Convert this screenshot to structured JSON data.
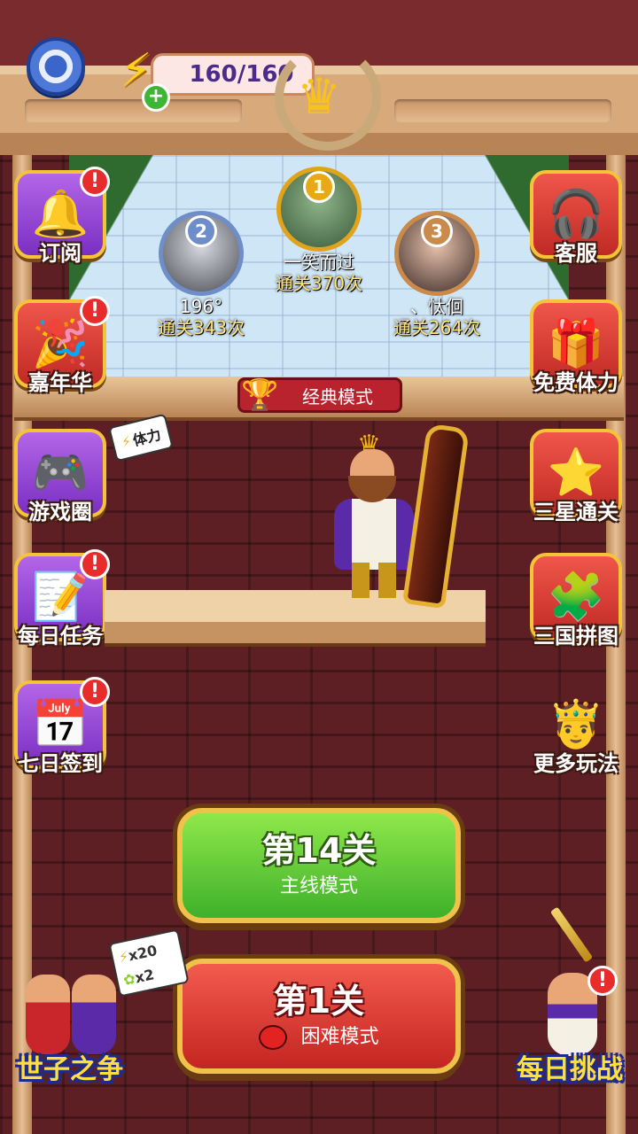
{
  "topbar": {
    "energy": "160/160",
    "plus": "+"
  },
  "leaderboard": {
    "mode_label": "经典模式",
    "players": [
      {
        "rank": "1",
        "name": "一笑而过",
        "count": "通关370次"
      },
      {
        "rank": "2",
        "name": "196°",
        "count": "通关343次"
      },
      {
        "rank": "3",
        "name": "、忲佪",
        "count": "通关264次"
      }
    ]
  },
  "left_menu": [
    {
      "label": "订阅",
      "icon": "bell-icon",
      "glyph": "🔔",
      "badge": "!"
    },
    {
      "label": "嘉年华",
      "icon": "party-popper-icon",
      "glyph": "🎉",
      "badge": "!"
    },
    {
      "label": "游戏圈",
      "icon": "gamepad-icon",
      "glyph": "🎮",
      "tag": "体力"
    },
    {
      "label": "每日任务",
      "icon": "notebook-pencil-icon",
      "glyph": "📝",
      "badge": "!"
    },
    {
      "label": "七日签到",
      "icon": "calendar-check-icon",
      "glyph": "📅",
      "badge": "!"
    }
  ],
  "right_menu": [
    {
      "label": "客服",
      "icon": "headset-icon",
      "glyph": "🎧"
    },
    {
      "label": "免费体力",
      "icon": "gift-box-icon",
      "glyph": "🎁"
    },
    {
      "label": "三星通关",
      "icon": "stars-crown-icon",
      "glyph": "⭐"
    },
    {
      "label": "三国拼图",
      "icon": "jigsaw-puzzle-icon",
      "glyph": "🧩"
    },
    {
      "label": "更多玩法",
      "icon": "king-character-icon",
      "glyph": "🤴"
    }
  ],
  "main_modes": {
    "main": {
      "level": "第14关",
      "mode": "主线模式"
    },
    "hard": {
      "level": "第1关",
      "mode": "困难模式"
    }
  },
  "bottom": {
    "left_label": "世子之争",
    "right_label": "每日挑战",
    "right_badge": "!",
    "reward_energy": "x20",
    "reward_puzzle": "x2"
  },
  "colors": {
    "brick": "#5e1f24",
    "gold": "#f1c24a",
    "green": "#3fb02a",
    "red": "#c42521",
    "purple": "#7a2fc2"
  }
}
